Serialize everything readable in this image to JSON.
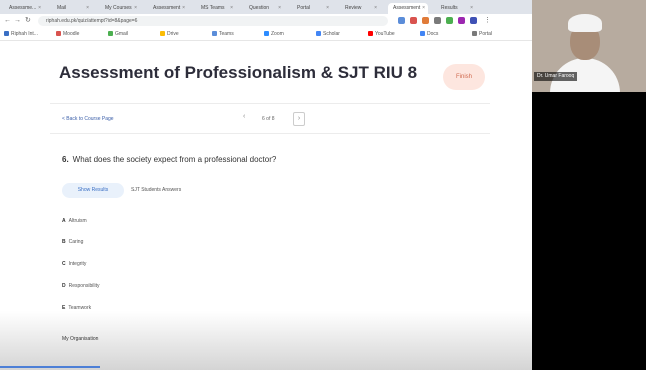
{
  "browser": {
    "tabs": [
      "Assessme...",
      "Mail",
      "My Courses",
      "Assessment",
      "MS Teams",
      "Question",
      "Portal",
      "Review",
      "Assessment",
      "Results"
    ],
    "active_tab_index": 8,
    "url": "riphah.edu.pk/quiz/attempt?id=8&page=6",
    "bookmarks": [
      "Riphah Int...",
      "Moodle",
      "Gmail",
      "Drive",
      "Teams",
      "Zoom",
      "Scholar",
      "YouTube",
      "Docs",
      "Portal"
    ]
  },
  "page": {
    "title": "Assessment of Professionalism & SJT RIU 8",
    "finish_label": "Finish",
    "back_link": "< Back to Course Page",
    "pager_prev": "‹",
    "pager_text": "6 of 8",
    "pager_next": "›",
    "question_number": "6.",
    "question_text": "What does the society expect from a professional doctor?",
    "tabs": {
      "active": "Show Results",
      "other": "SJT Students Answers"
    },
    "options": [
      {
        "letter": "A",
        "text": "Altruism"
      },
      {
        "letter": "B",
        "text": "Caring"
      },
      {
        "letter": "C",
        "text": "Integrity"
      },
      {
        "letter": "D",
        "text": "Responsibility"
      },
      {
        "letter": "E",
        "text": "Teamwork"
      }
    ],
    "bottom_option": "My Organisation"
  },
  "video": {
    "participant_name": "Dr. Umar Farooq"
  },
  "colors": {
    "accent": "#3a6fc4",
    "finish_bg": "#fde6df",
    "finish_text": "#d06a4f"
  }
}
